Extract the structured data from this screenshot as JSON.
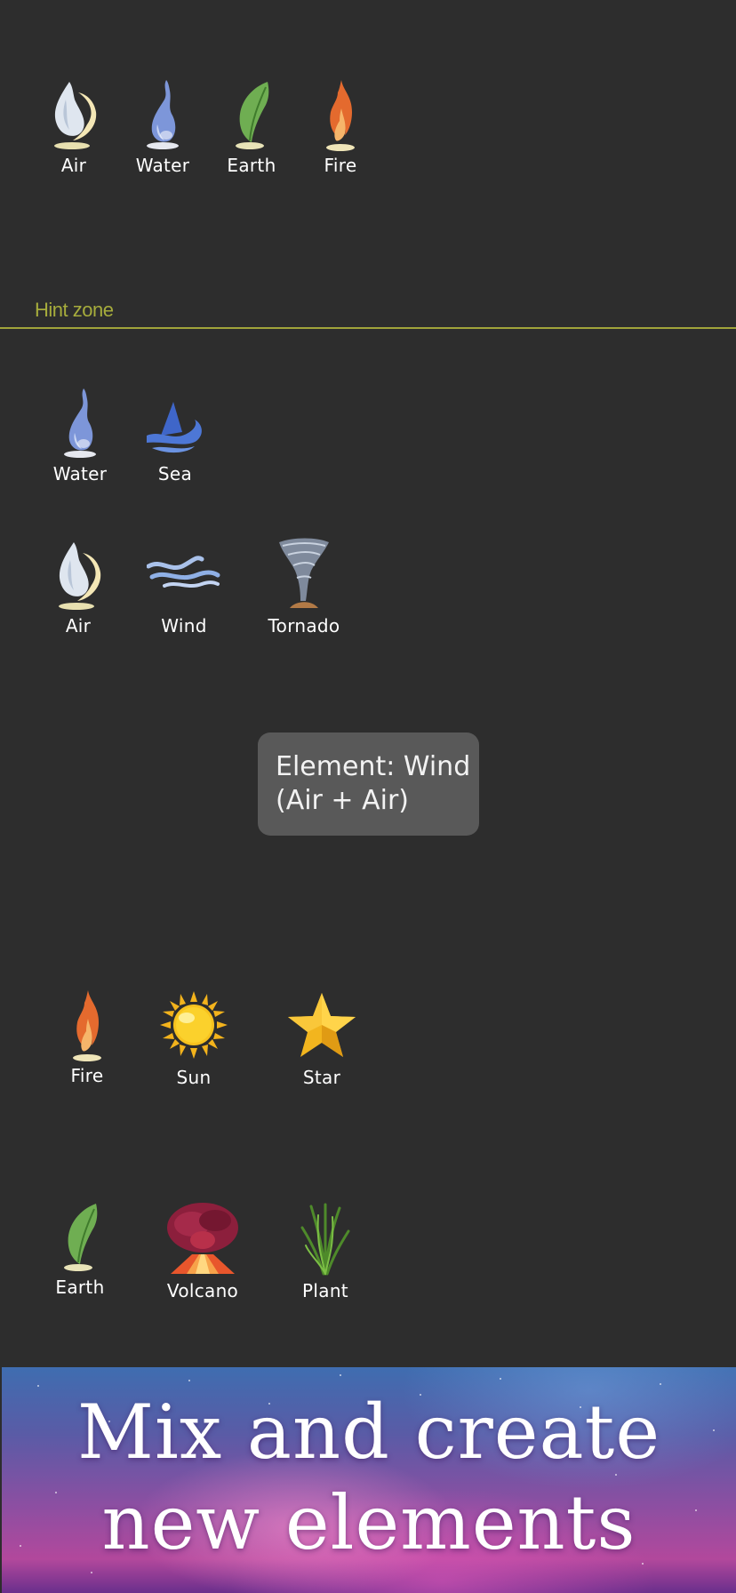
{
  "top_elements": [
    {
      "label": "Air",
      "icon": "air-icon"
    },
    {
      "label": "Water",
      "icon": "water-icon"
    },
    {
      "label": "Earth",
      "icon": "earth-icon"
    },
    {
      "label": "Fire",
      "icon": "fire-icon"
    }
  ],
  "hint_zone": {
    "label": "Hint zone",
    "color": "#a6ac3c"
  },
  "recipes": [
    {
      "inputs": [
        "Water"
      ],
      "result": "Sea"
    },
    {
      "inputs": [
        "Air",
        "Wind"
      ],
      "result": "Tornado"
    },
    {
      "inputs": [
        "Fire",
        "Sun"
      ],
      "result": "Star"
    },
    {
      "inputs": [
        "Earth",
        "Volcano"
      ],
      "result": "Plant"
    }
  ],
  "tooltip": {
    "line1": "Element: Wind",
    "line2": "(Air + Air)"
  },
  "banner": {
    "line1": "Mix and create",
    "line2": "new elements"
  }
}
